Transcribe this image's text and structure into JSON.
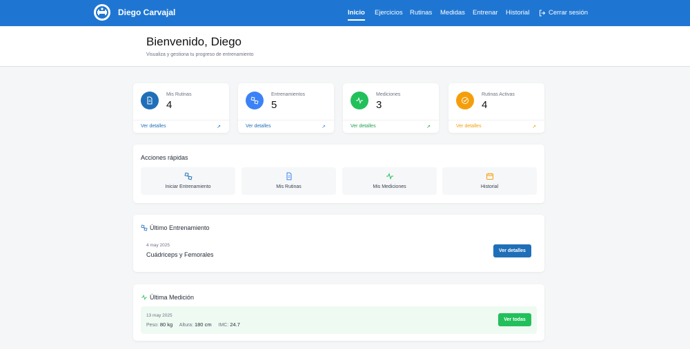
{
  "navbar": {
    "brand_name": "Diego Carvajal",
    "links": [
      {
        "label": "Inicio",
        "active": true
      },
      {
        "label": "Ejercicios",
        "active": false
      },
      {
        "label": "Rutinas",
        "active": false
      },
      {
        "label": "Medidas",
        "active": false
      },
      {
        "label": "Entrenar",
        "active": false
      },
      {
        "label": "Historial",
        "active": false
      }
    ],
    "logout_label": "Cerrar sesión",
    "color": "#1f76d2"
  },
  "header": {
    "title": "Bienvenido, Diego",
    "subtitle": "Visualiza y gestiona tu progreso de entrenamiento"
  },
  "stats": [
    {
      "label": "Mis Rutinas",
      "value": "4",
      "link": "Ver detalles",
      "icon": "document-icon",
      "color": "#1f6fb8"
    },
    {
      "label": "Entrenamientos",
      "value": "5",
      "link": "Ver detalles",
      "icon": "dumbbell-icon",
      "color": "#3b82f6"
    },
    {
      "label": "Mediciones",
      "value": "3",
      "link": "Ver detalles",
      "icon": "activity-icon",
      "color": "#22c05a"
    },
    {
      "label": "Rutinas Activas",
      "value": "4",
      "link": "Ver detalles",
      "icon": "check-circle-icon",
      "color": "#f59e0b"
    }
  ],
  "quick_actions": {
    "title": "Acciones rápidas",
    "items": [
      {
        "label": "Iniciar Entrenamiento",
        "icon": "dumbbell-icon",
        "color": "#1f6fb8"
      },
      {
        "label": "Mis Rutinas",
        "icon": "document-icon",
        "color": "#3b82f6"
      },
      {
        "label": "Mis Mediciones",
        "icon": "activity-icon",
        "color": "#22c05a"
      },
      {
        "label": "Historial",
        "icon": "calendar-icon",
        "color": "#f59e0b"
      }
    ]
  },
  "last_training": {
    "title": "Último Entrenamiento",
    "date": "4 may 2025",
    "name": "Cuádriceps y Femorales",
    "button": "Ver detalles"
  },
  "last_measurement": {
    "title": "Última Medición",
    "date": "13 may 2025",
    "weight_label": "Peso:",
    "weight": "80 kg",
    "height_label": "Altura:",
    "height": "180 cm",
    "bmi_label": "IMC:",
    "bmi": "24.7",
    "button": "Ver todas"
  }
}
